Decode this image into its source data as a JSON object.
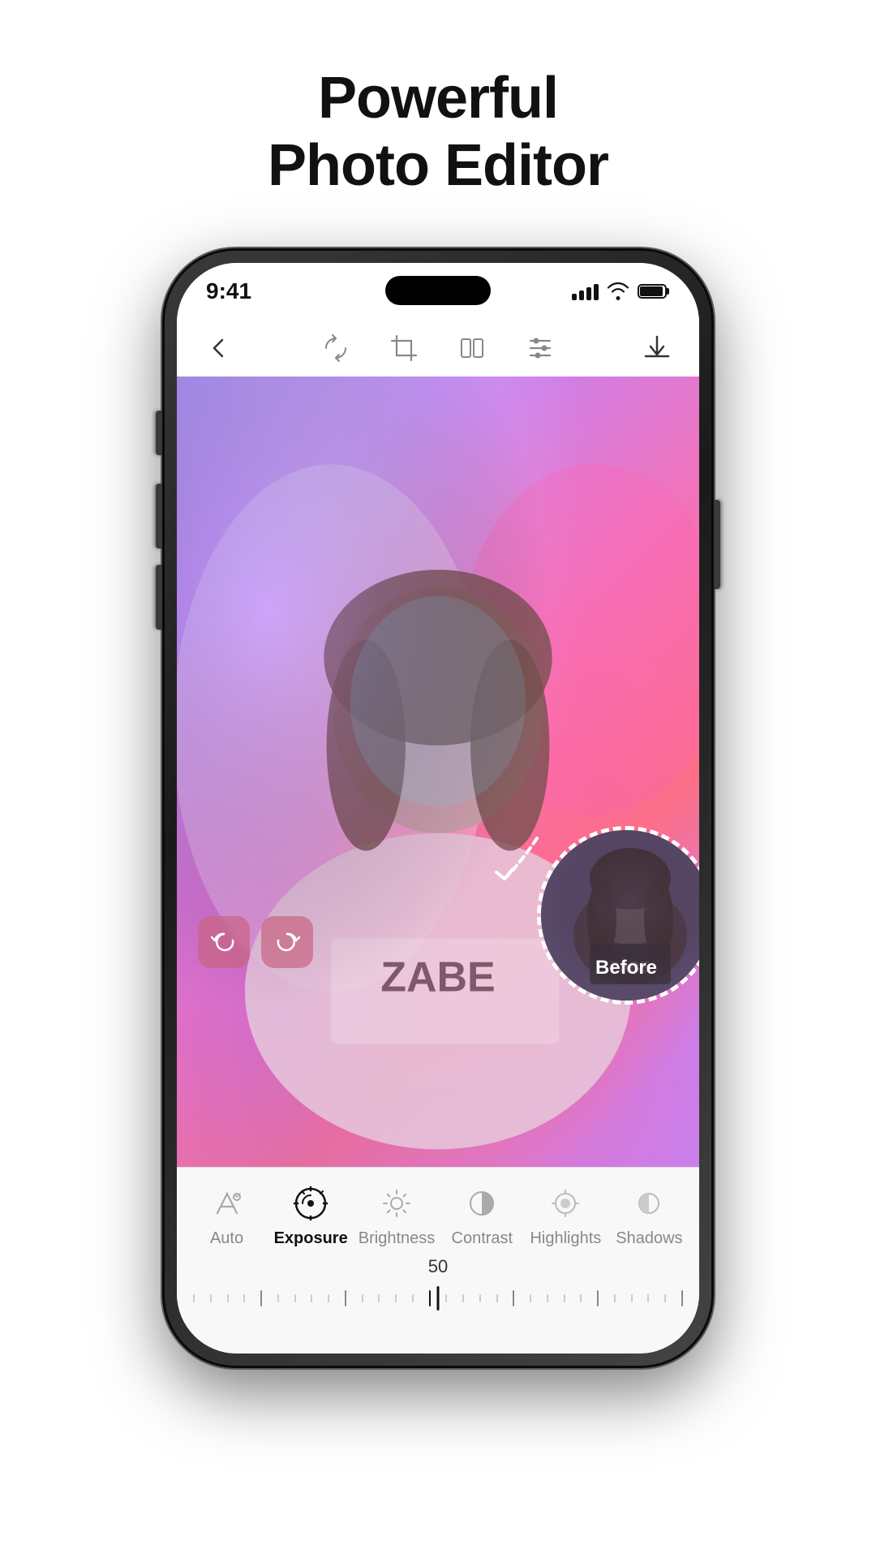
{
  "page": {
    "title_line1": "Powerful",
    "title_line2": "Photo Editor"
  },
  "status_bar": {
    "time": "9:41"
  },
  "toolbar": {
    "back_label": "back",
    "icons": [
      "rotate-icon",
      "crop-icon",
      "flip-icon",
      "filter-icon",
      "download-icon"
    ]
  },
  "before_label": "Before",
  "undo_label": "undo",
  "redo_label": "redo",
  "bottom_panel": {
    "slider_value": "50",
    "tabs": [
      {
        "id": "auto",
        "label": "Auto",
        "active": false
      },
      {
        "id": "exposure",
        "label": "Exposure",
        "active": true
      },
      {
        "id": "brightness",
        "label": "Brightness",
        "active": false
      },
      {
        "id": "contrast",
        "label": "Contrast",
        "active": false
      },
      {
        "id": "highlights",
        "label": "Highlights",
        "active": false
      },
      {
        "id": "shadows",
        "label": "Shadows",
        "active": false
      }
    ]
  },
  "colors": {
    "accent_pink": "#d9527a",
    "active_tab": "#111111",
    "inactive_tab": "#888888"
  }
}
